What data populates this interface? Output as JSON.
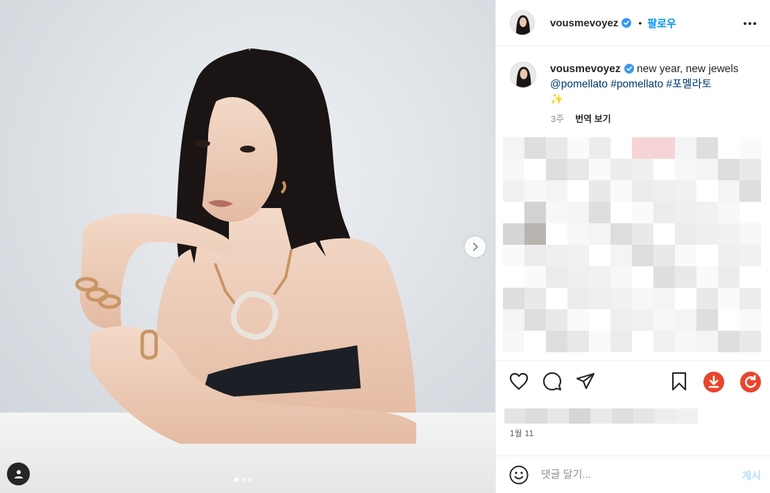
{
  "post": {
    "username": "vousmevoyez",
    "verified": true,
    "follow_label": "팔로우",
    "separator": "•",
    "caption_text": "new year, new jewels",
    "caption_mentions": [
      {
        "text": "@pomellato"
      },
      {
        "text": "#pomellato"
      },
      {
        "text": "#포멜라토"
      }
    ],
    "caption_emoji": "✨",
    "caption_age": "3주",
    "translate_label": "번역 보기",
    "date": "1월 11",
    "carousel": {
      "count": 3,
      "active_index": 0
    }
  },
  "comment_box": {
    "placeholder": "댓글 달기...",
    "post_label": "게시"
  },
  "icons": {
    "like": "heart-icon",
    "comment": "comment-icon",
    "share": "send-icon",
    "save": "bookmark-icon",
    "download": "download-icon",
    "refresh": "refresh-icon",
    "more": "more-options-icon",
    "emoji": "emoji-icon",
    "tag": "user-tag-icon",
    "next": "chevron-right-icon"
  },
  "colors": {
    "brand_blue": "#0095f6",
    "link": "#00376b",
    "verified": "#3897f0",
    "download_red": "#e8452c",
    "post_disabled": "#b2dffc"
  }
}
